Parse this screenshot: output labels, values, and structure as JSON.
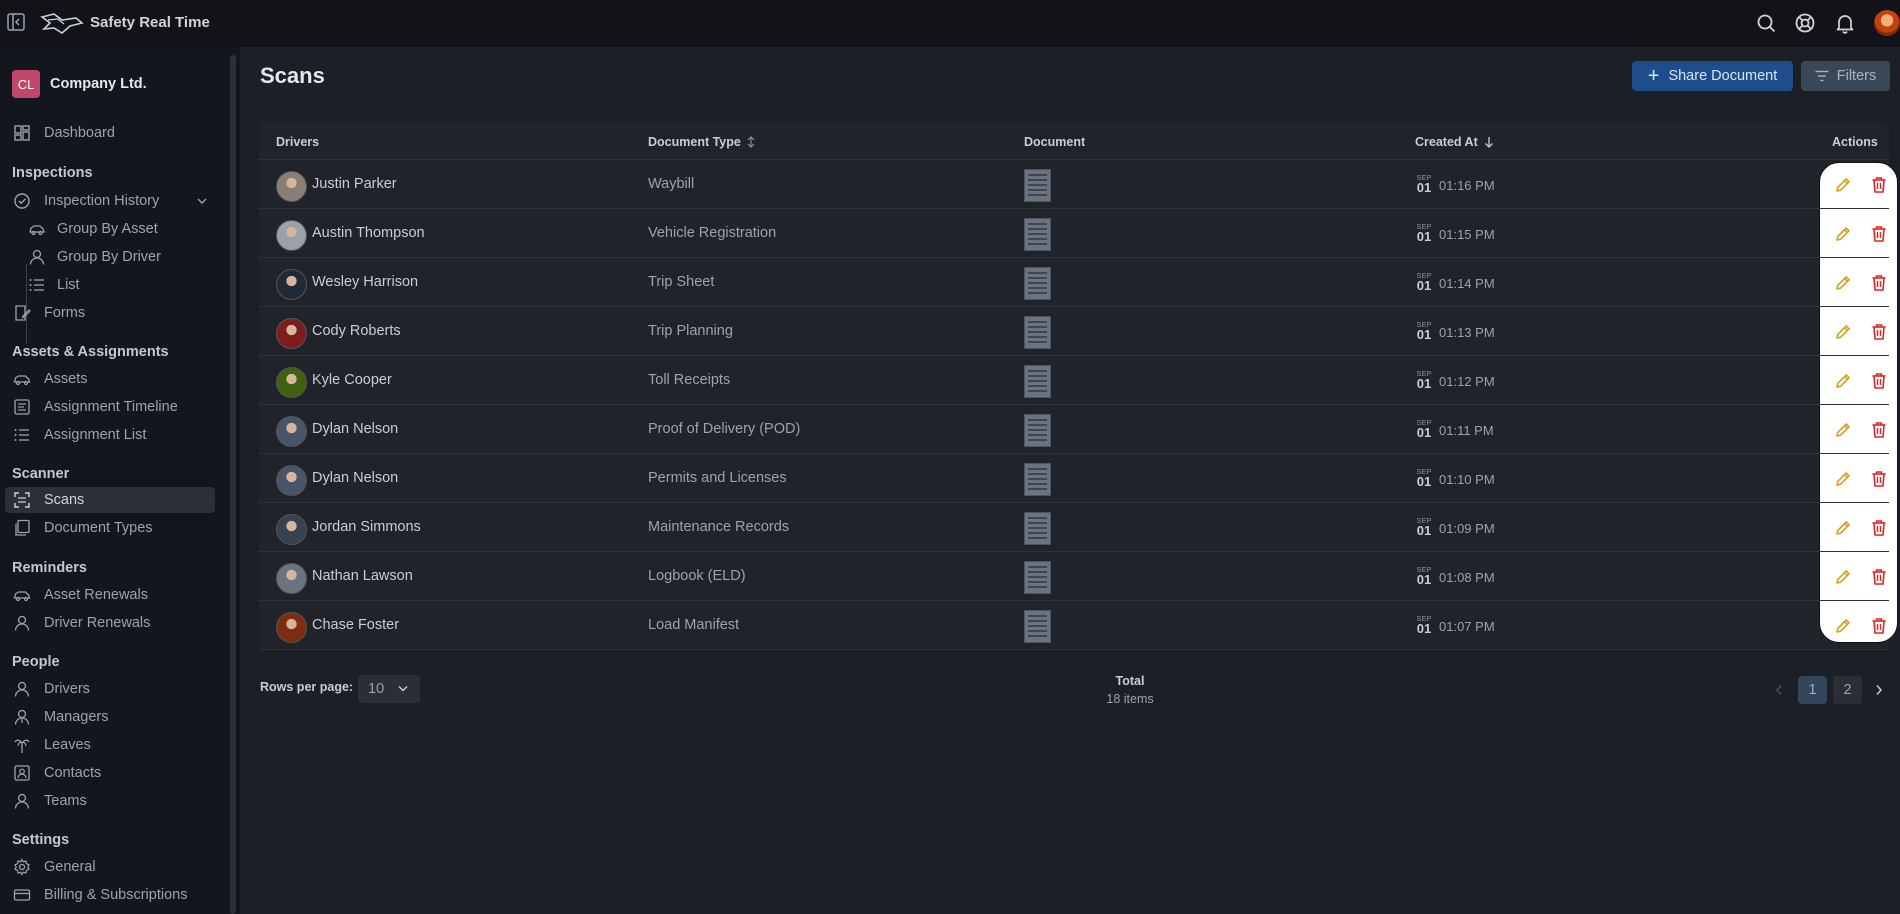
{
  "app": {
    "brand": "Safety Real Time"
  },
  "company": {
    "initials": "CL",
    "name": "Company Ltd."
  },
  "sidebar": {
    "dashboard": "Dashboard",
    "inspections": {
      "heading": "Inspections",
      "history": "Inspection History",
      "group_by_asset": "Group By Asset",
      "group_by_driver": "Group By Driver",
      "list": "List",
      "forms": "Forms"
    },
    "assets": {
      "heading": "Assets & Assignments",
      "assets": "Assets",
      "timeline": "Assignment Timeline",
      "list": "Assignment List"
    },
    "scanner": {
      "heading": "Scanner",
      "scans": "Scans",
      "document_types": "Document Types"
    },
    "reminders": {
      "heading": "Reminders",
      "asset_renewals": "Asset Renewals",
      "driver_renewals": "Driver Renewals"
    },
    "people": {
      "heading": "People",
      "drivers": "Drivers",
      "managers": "Managers",
      "leaves": "Leaves",
      "contacts": "Contacts",
      "teams": "Teams"
    },
    "settings": {
      "heading": "Settings",
      "general": "General",
      "billing": "Billing & Subscriptions"
    }
  },
  "page": {
    "title": "Scans",
    "share_label": "Share Document",
    "filters_label": "Filters"
  },
  "table": {
    "headers": {
      "drivers": "Drivers",
      "document_type": "Document Type",
      "document": "Document",
      "created_at": "Created At",
      "actions": "Actions"
    },
    "rows": [
      {
        "driver": "Justin Parker",
        "type": "Waybill",
        "month": "SEP",
        "day": "01",
        "time": "01:16 PM"
      },
      {
        "driver": "Austin Thompson",
        "type": "Vehicle Registration",
        "month": "SEP",
        "day": "01",
        "time": "01:15 PM"
      },
      {
        "driver": "Wesley Harrison",
        "type": "Trip Sheet",
        "month": "SEP",
        "day": "01",
        "time": "01:14 PM"
      },
      {
        "driver": "Cody Roberts",
        "type": "Trip Planning",
        "month": "SEP",
        "day": "01",
        "time": "01:13 PM"
      },
      {
        "driver": "Kyle Cooper",
        "type": "Toll Receipts",
        "month": "SEP",
        "day": "01",
        "time": "01:12 PM"
      },
      {
        "driver": "Dylan Nelson",
        "type": "Proof of Delivery (POD)",
        "month": "SEP",
        "day": "01",
        "time": "01:11 PM"
      },
      {
        "driver": "Dylan Nelson",
        "type": "Permits and Licenses",
        "month": "SEP",
        "day": "01",
        "time": "01:10 PM"
      },
      {
        "driver": "Jordan Simmons",
        "type": "Maintenance Records",
        "month": "SEP",
        "day": "01",
        "time": "01:09 PM"
      },
      {
        "driver": "Nathan Lawson",
        "type": "Logbook (ELD)",
        "month": "SEP",
        "day": "01",
        "time": "01:08 PM"
      },
      {
        "driver": "Chase Foster",
        "type": "Load Manifest",
        "month": "SEP",
        "day": "01",
        "time": "01:07 PM"
      }
    ]
  },
  "pagination": {
    "rows_per_page_label": "Rows per page:",
    "rows_per_page": "10",
    "total_label": "Total",
    "total_items": "18 items",
    "pages": [
      "1",
      "2"
    ],
    "current_page": "1"
  },
  "colors": {
    "primary": "#1e4d8c",
    "edit": "#d4a017",
    "delete": "#dc2626",
    "badge": "#c2456a"
  },
  "icons": [
    "sidebar-collapse-icon",
    "logo-icon",
    "search-icon",
    "support-icon",
    "bell-icon",
    "dashboard-icon",
    "inspection-icon",
    "asset-car-icon",
    "user-icon",
    "list-icon",
    "forms-icon",
    "timeline-icon",
    "scan-icon",
    "document-types-icon",
    "team-icon",
    "gear-icon",
    "billing-icon",
    "edit-icon",
    "trash-icon",
    "sort-icon",
    "arrow-down-icon",
    "filter-icon",
    "chevron-down-icon",
    "chevron-left-icon",
    "chevron-right-icon"
  ]
}
